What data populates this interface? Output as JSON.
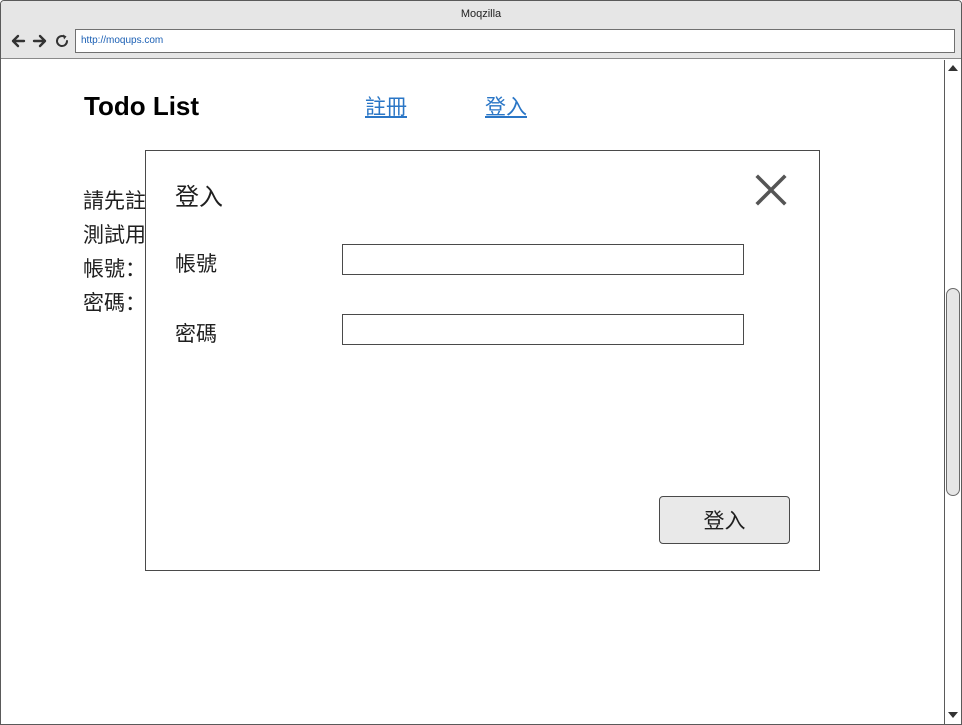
{
  "browser": {
    "window_title": "Moqzilla",
    "address": "http://moqups.com"
  },
  "header": {
    "app_title": "Todo List",
    "nav": [
      {
        "label": "註冊"
      },
      {
        "label": "登入"
      }
    ]
  },
  "background_info": {
    "lines": [
      "請先註",
      "測試用",
      "帳號：",
      "密碼："
    ]
  },
  "login_modal": {
    "title": "登入",
    "fields": [
      {
        "label": "帳號",
        "value": "",
        "placeholder": ""
      },
      {
        "label": "密碼",
        "value": "",
        "placeholder": ""
      }
    ],
    "submit_label": "登入"
  },
  "colors": {
    "link": "#2a76c6",
    "chrome": "#e6e6e6",
    "button": "#e9e9e9"
  },
  "icons": {
    "back": "arrow-left-icon",
    "forward": "arrow-right-icon",
    "reload": "reload-icon",
    "close": "close-icon"
  }
}
